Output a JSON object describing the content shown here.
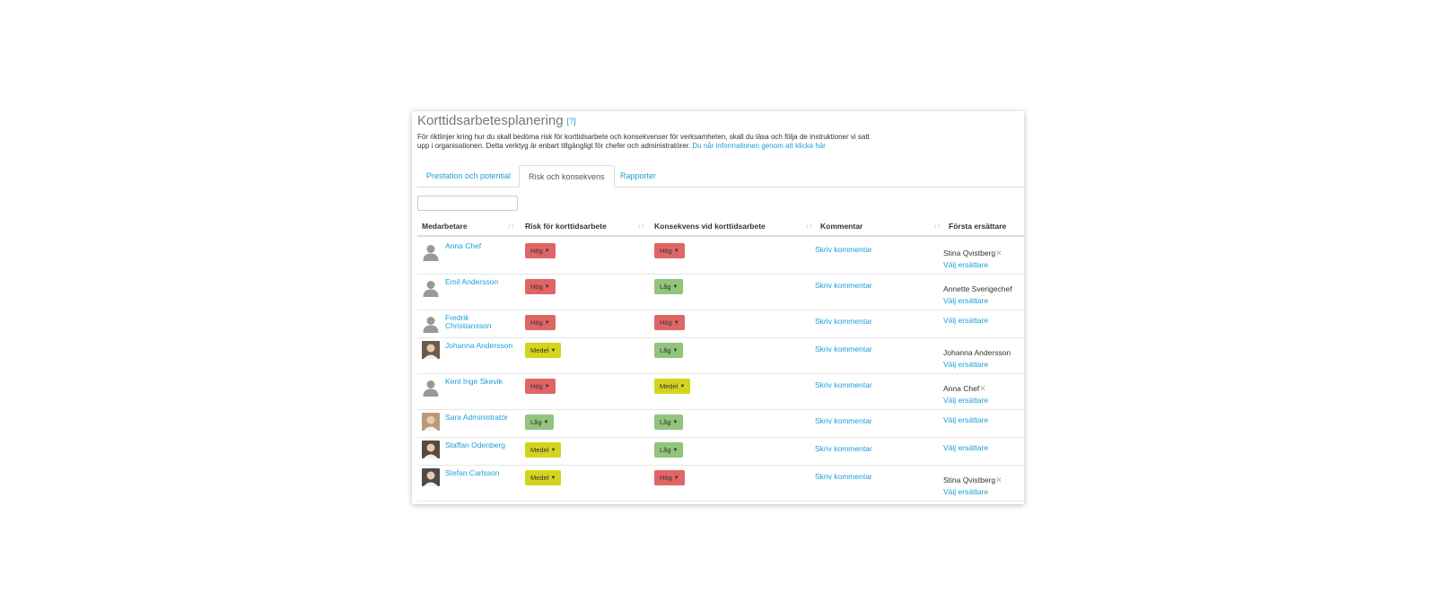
{
  "page": {
    "title": "Korttidsarbetesplanering",
    "help": "[?]",
    "description": "För riktlinjer kring hur du skall bedöma risk för korttidsarbete och konsekvenser för verksamheten, skall du läsa och följa de instruktioner vi satt upp i organisationen. Detta verktyg är enbart tillgängligt för chefer och administratörer.",
    "description_link": "Du når informationen genom att klicka här"
  },
  "tabs": [
    {
      "label": "Prestation och potential"
    },
    {
      "label": "Risk och konsekvens"
    },
    {
      "label": "Rapporter"
    }
  ],
  "search": {
    "value": ""
  },
  "table": {
    "headers": [
      "Medarbetare",
      "Risk för korttidsarbete",
      "Konsekvens vid korttidsarbete",
      "Kommentar",
      "Första ersättare"
    ],
    "sort_icon": "↓↑",
    "rows": [
      {
        "name": "Anna Chef",
        "avatar": "person-icon",
        "risk": "Hög",
        "konsekvens": "Hög",
        "comment": "Skriv kommentar",
        "substitute": "Stina Qvistberg",
        "remove": "✕",
        "choose": "Välj ersättare"
      },
      {
        "name": "Emil Andersson",
        "avatar": "person-icon",
        "risk": "Hög",
        "konsekvens": "Låg",
        "comment": "Skriv kommentar",
        "substitute": "Annette Sverigechef",
        "remove": "",
        "choose": "Välj ersättare"
      },
      {
        "name": "Fredrik Christiansson",
        "avatar": "person-icon",
        "risk": "Hög",
        "konsekvens": "Hög",
        "comment": "Skriv kommentar",
        "substitute": "",
        "remove": "",
        "choose": "Välj ersättare"
      },
      {
        "name": "Johanna Andersson",
        "avatar": "photo",
        "risk": "Medel",
        "konsekvens": "Låg",
        "comment": "Skriv kommentar",
        "substitute": "Johanna Andersson",
        "remove": "",
        "choose": "Välj ersättare"
      },
      {
        "name": "Kent Inge Skevik",
        "avatar": "person-icon",
        "risk": "Hög",
        "konsekvens": "Medel",
        "comment": "Skriv kommentar",
        "substitute": "Anna Chef",
        "remove": "✕",
        "choose": "Välj ersättare"
      },
      {
        "name": "Sara Administratör",
        "avatar": "photo",
        "risk": "Låg",
        "konsekvens": "Låg",
        "comment": "Skriv kommentar",
        "substitute": "",
        "remove": "",
        "choose": "Välj ersättare"
      },
      {
        "name": "Staffan Odenberg",
        "avatar": "photo",
        "risk": "Medel",
        "konsekvens": "Låg",
        "comment": "Skriv kommentar",
        "substitute": "",
        "remove": "",
        "choose": "Välj ersättare"
      },
      {
        "name": "Stefan Carlsson",
        "avatar": "photo",
        "risk": "Medel",
        "konsekvens": "Hög",
        "comment": "Skriv kommentar",
        "substitute": "Stina Qvistberg",
        "remove": "✕",
        "choose": "Välj ersättare"
      }
    ]
  },
  "colors": {
    "link": "#1a9fd6",
    "hog": "#e06666",
    "lag": "#93c47d",
    "medel": "#d4d41e"
  }
}
